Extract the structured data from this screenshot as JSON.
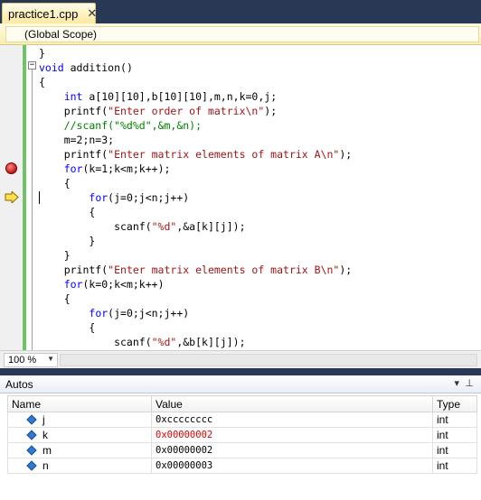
{
  "tab": {
    "title": "practice1.cpp",
    "close": "✕"
  },
  "scope": {
    "label": "(Global Scope)"
  },
  "editor": {
    "lines": [
      [
        [
          "p",
          "}"
        ]
      ],
      [
        [
          "k",
          "void"
        ],
        [
          "p",
          " addition()"
        ]
      ],
      [
        [
          "p",
          "{"
        ]
      ],
      [
        [
          "p",
          "    "
        ],
        [
          "k",
          "int"
        ],
        [
          "p",
          " a[10][10],b[10][10],m,n,k=0,j;"
        ]
      ],
      [
        [
          "p",
          "    printf("
        ],
        [
          "s",
          "\"Enter order of matrix\\n\""
        ],
        [
          "p",
          ");"
        ]
      ],
      [
        [
          "c",
          "    //scanf(\"%d%d\",&m,&n);"
        ]
      ],
      [
        [
          "p",
          "    m=2;n=3;"
        ]
      ],
      [
        [
          "p",
          "    printf("
        ],
        [
          "s",
          "\"Enter matrix elements of matrix A\\n\""
        ],
        [
          "p",
          ");"
        ]
      ],
      [
        [
          "p",
          "    "
        ],
        [
          "k",
          "for"
        ],
        [
          "p",
          "(k=1;k<m;k++);"
        ]
      ],
      [
        [
          "p",
          "    {"
        ]
      ],
      [
        [
          "p",
          "        "
        ],
        [
          "k",
          "for"
        ],
        [
          "p",
          "(j=0;j<n;j++)"
        ]
      ],
      [
        [
          "p",
          "        {"
        ]
      ],
      [
        [
          "p",
          "            scanf("
        ],
        [
          "s",
          "\"%d\""
        ],
        [
          "p",
          ",&a[k][j]);"
        ]
      ],
      [
        [
          "p",
          "        }"
        ]
      ],
      [
        [
          "p",
          "    }"
        ]
      ],
      [
        [
          "p",
          "    printf("
        ],
        [
          "s",
          "\"Enter matrix elements of matrix B\\n\""
        ],
        [
          "p",
          ");"
        ]
      ],
      [
        [
          "p",
          "    "
        ],
        [
          "k",
          "for"
        ],
        [
          "p",
          "(k=0;k<m;k++)"
        ]
      ],
      [
        [
          "p",
          "    {"
        ]
      ],
      [
        [
          "p",
          "        "
        ],
        [
          "k",
          "for"
        ],
        [
          "p",
          "(j=0;j<n;j++)"
        ]
      ],
      [
        [
          "p",
          "        {"
        ]
      ],
      [
        [
          "p",
          "            scanf("
        ],
        [
          "s",
          "\"%d\""
        ],
        [
          "p",
          ",&b[k][j]);"
        ]
      ],
      [
        [
          "p",
          "        }"
        ]
      ]
    ],
    "breakpoint_line": 8,
    "current_line": 10
  },
  "zoom": {
    "value": "100 %"
  },
  "autos": {
    "title": "Autos",
    "pin": "▾",
    "dock": "⊥",
    "columns": [
      "Name",
      "Value",
      "Type"
    ],
    "rows": [
      {
        "name": "j",
        "value": "0xcccccccc",
        "type": "int",
        "changed": false
      },
      {
        "name": "k",
        "value": "0x00000002",
        "type": "int",
        "changed": true
      },
      {
        "name": "m",
        "value": "0x00000002",
        "type": "int",
        "changed": false
      },
      {
        "name": "n",
        "value": "0x00000003",
        "type": "int",
        "changed": false
      }
    ]
  },
  "colors": {
    "keyword": "#0000ff",
    "string": "#a31515",
    "comment": "#008000",
    "changed_value": "#e00000"
  }
}
